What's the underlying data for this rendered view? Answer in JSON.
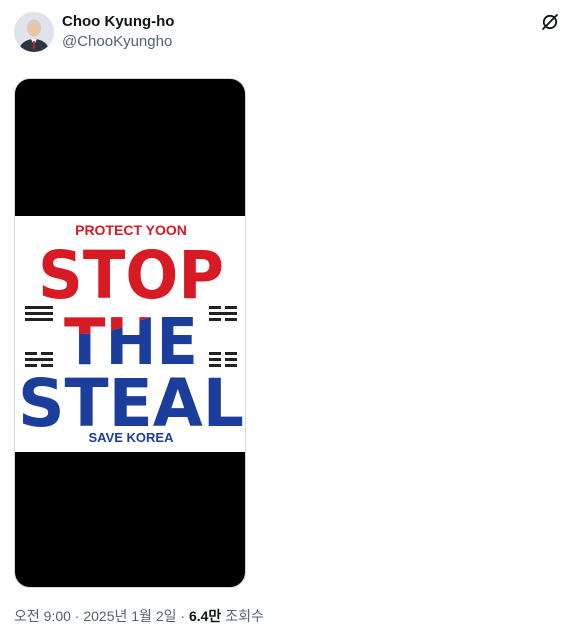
{
  "author": {
    "display_name": "Choo Kyung-ho",
    "handle": "@ChooKyungho"
  },
  "header": {
    "grok_icon": "grok-icon"
  },
  "media": {
    "poster": {
      "top_line": "PROTECT YOON",
      "word_1": "STOP",
      "word_2": "THE",
      "word_3": "STEAL",
      "bottom_line": "SAVE KOREA"
    },
    "colors": {
      "red": "#d81a24",
      "blue": "#1b3e9c",
      "trigram": "#222222"
    }
  },
  "meta": {
    "time": "오전 9:00",
    "separator": " · ",
    "date": "2025년 1월 2일",
    "views_count": "6.4만",
    "views_label": " 조회수"
  }
}
